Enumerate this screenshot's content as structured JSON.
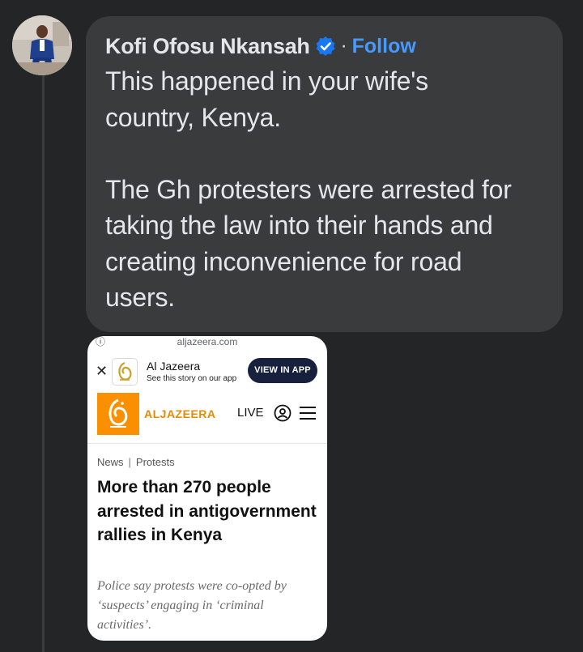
{
  "comment": {
    "author": "Kofi Ofosu Nkansah",
    "separator": "·",
    "follow_label": "Follow",
    "text": "This happened in your wife's\ncountry, Kenya.\n\nThe Gh protesters were arrested for\ntaking the law into their hands and\ncreating inconvenience for road\nusers."
  },
  "attachment": {
    "url": "aljazeera.com",
    "banner": {
      "title": "Al Jazeera",
      "subtitle": "See this story on our app",
      "button": "VIEW IN APP"
    },
    "site": {
      "wordmark": "ALJAZEERA",
      "live": "LIVE"
    },
    "breadcrumb": {
      "section": "News",
      "separator": "|",
      "topic": "Protests"
    },
    "headline": "More than 270 people arrested in antigovernment rallies in Kenya",
    "dek": "Police say protests were co-opted by ‘suspects’ engaging in ‘criminal activities’."
  },
  "colors": {
    "background": "#242526",
    "bubble": "#3a3b3c",
    "follow": "#4599ff",
    "aj_orange": "#fa9000",
    "view_app_button": "#17213d"
  },
  "icons": [
    "verified-badge-icon",
    "close-icon",
    "al-jazeera-logo",
    "user-account-icon",
    "hamburger-menu-icon"
  ]
}
